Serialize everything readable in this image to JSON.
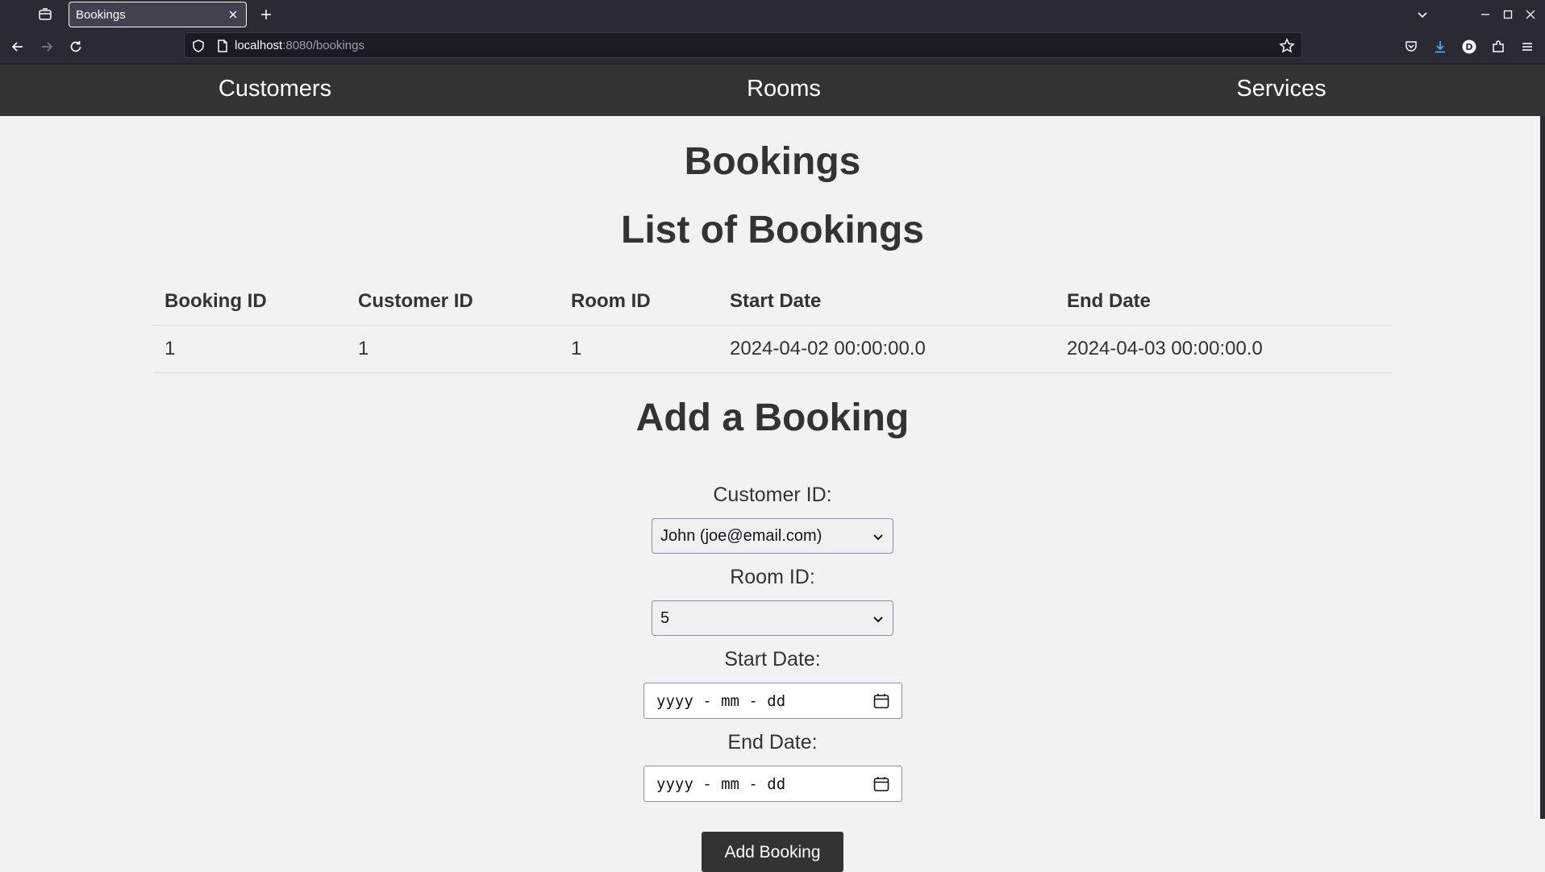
{
  "browser": {
    "tab_title": "Bookings",
    "url_host": "localhost",
    "url_rest": ":8080/bookings"
  },
  "nav": {
    "customers": "Customers",
    "rooms": "Rooms",
    "services": "Services"
  },
  "page": {
    "title": "Bookings",
    "list_heading": "List of Bookings",
    "add_heading": "Add a Booking"
  },
  "table": {
    "headers": [
      "Booking ID",
      "Customer ID",
      "Room ID",
      "Start Date",
      "End Date"
    ],
    "rows": [
      [
        "1",
        "1",
        "1",
        "2024-04-02 00:00:00.0",
        "2024-04-03 00:00:00.0"
      ]
    ]
  },
  "form": {
    "customer_label": "Customer ID:",
    "customer_value": "John (joe@email.com)",
    "room_label": "Room ID:",
    "room_value": "5",
    "start_label": "Start Date:",
    "start_placeholder": "yyyy - mm - dd",
    "end_label": "End Date:",
    "end_placeholder": "yyyy - mm - dd",
    "submit_label": "Add Booking"
  },
  "icons": {
    "tab_list": "tab-list-icon",
    "close_tab": "close-icon",
    "new_tab": "plus-icon",
    "back": "arrow-left-icon",
    "forward": "arrow-right-icon",
    "reload": "reload-icon",
    "calendar": "calendar-icon"
  }
}
